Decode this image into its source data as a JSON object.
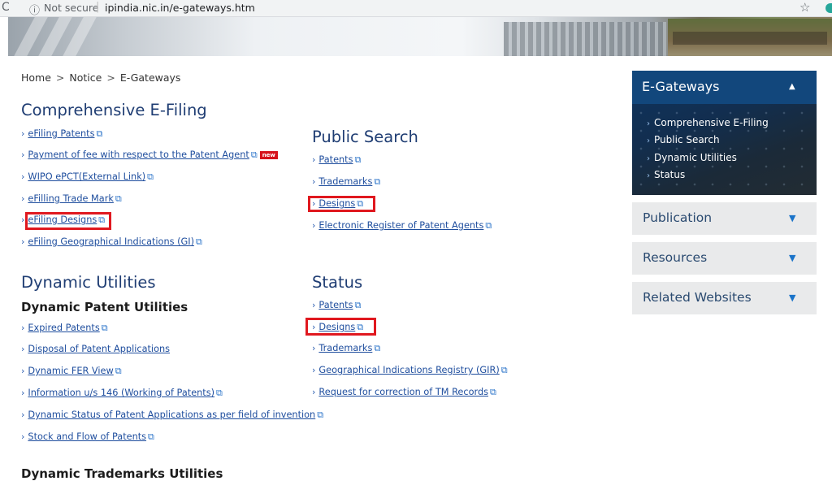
{
  "browser": {
    "back_glyph": "C",
    "security_label": "Not secure",
    "separator": "|",
    "url": "ipindia.nic.in/e-gateways.htm"
  },
  "breadcrumb": {
    "home": "Home",
    "notice": "Notice",
    "current": "E-Gateways",
    "separator": ">"
  },
  "comprehensive": {
    "title": "Comprehensive E-Filing",
    "items": [
      "eFiling Patents",
      "Payment of fee with respect to the Patent Agent",
      "WIPO ePCT(External Link)",
      "eFilling Trade Mark",
      "eFiling Designs",
      "eFiling Geographical Indications (GI)"
    ],
    "new_badge": "new"
  },
  "public_search": {
    "title": "Public Search",
    "items": [
      "Patents",
      "Trademarks",
      "Designs",
      "Electronic Register of Patent Agents"
    ]
  },
  "dynamic_utilities": {
    "title": "Dynamic Utilities",
    "patent_subtitle": "Dynamic Patent Utilities",
    "patent_items": [
      "Expired Patents",
      "Disposal of Patent Applications",
      "Dynamic FER View",
      "Information u/s 146 (Working of Patents)",
      "Dynamic Status of Patent Applications as per field of invention",
      "Stock and Flow of Patents"
    ],
    "trademark_subtitle": "Dynamic Trademarks Utilities"
  },
  "status": {
    "title": "Status",
    "items": [
      "Patents",
      "Designs",
      "Trademarks",
      "Geographical Indications Registry (GIR)",
      "Request for correction of TM Records"
    ]
  },
  "sidebar": {
    "active": {
      "title": "E-Gateways",
      "items": [
        "Comprehensive E-Filing",
        "Public Search",
        "Dynamic Utilities",
        "Status"
      ]
    },
    "collapsed": [
      "Publication",
      "Resources",
      "Related Websites"
    ]
  },
  "colors": {
    "heading": "#1f3d73",
    "link": "#1f4e9e",
    "highlight": "#e0181f",
    "sidebar_active": "#12477c"
  }
}
